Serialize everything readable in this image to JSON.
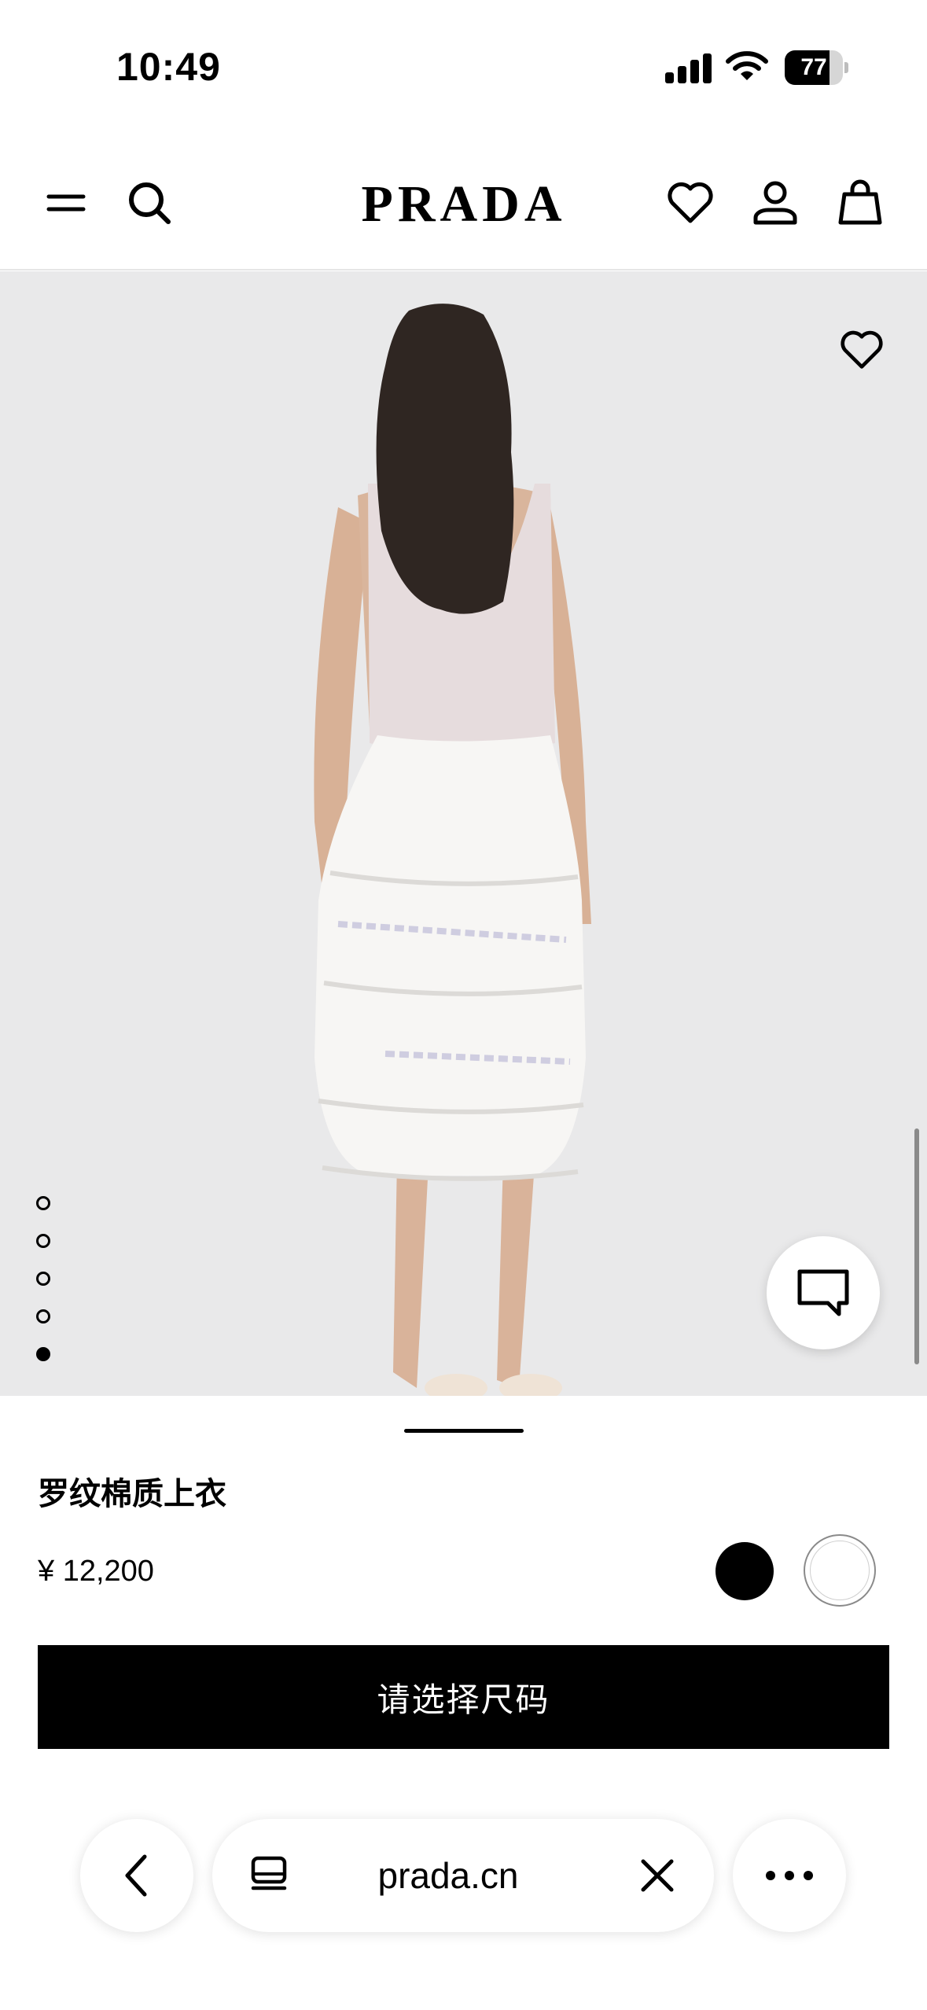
{
  "status_bar": {
    "time": "10:49",
    "battery_percent": "77",
    "battery_level": 0.77,
    "icons": [
      "signal-icon",
      "wifi-icon",
      "battery-icon"
    ]
  },
  "header": {
    "logo": "PRADA",
    "icons": [
      "menu-icon",
      "search-icon",
      "heart-icon",
      "account-icon",
      "bag-icon"
    ]
  },
  "gallery": {
    "image": "product-photo-back-view",
    "total_slides": 5,
    "active_slide_index": 5,
    "icons": [
      "heart-icon",
      "chat-icon"
    ]
  },
  "product": {
    "name": "罗纹棉质上衣",
    "price": "¥ 12,200",
    "colors": [
      {
        "name": "black",
        "hex": "#000000",
        "selected": false
      },
      {
        "name": "white",
        "hex": "#ffffff",
        "selected": true
      }
    ],
    "cta_label": "请选择尺码"
  },
  "browser": {
    "url": "prada.cn",
    "icons": [
      "back-chevron-icon",
      "tabs-icon",
      "close-icon",
      "more-icon"
    ]
  }
}
